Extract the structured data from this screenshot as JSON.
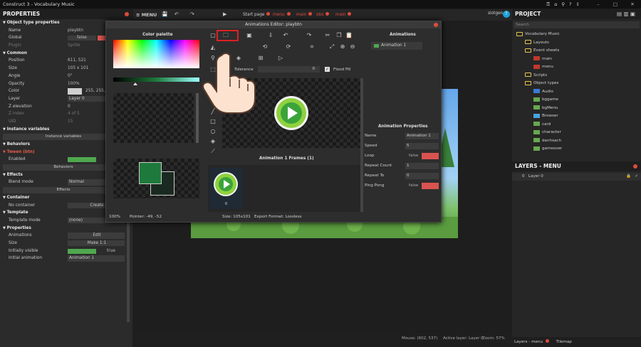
{
  "window": {
    "title": "Construct 3 - Vocabulary Music",
    "min": "–",
    "max": "□",
    "close": "✕"
  },
  "toolbar": {
    "menu_label": "≡ MENU",
    "username": "slotgen",
    "user_badge": "?"
  },
  "tabs": [
    {
      "label": "Start page"
    },
    {
      "label": "menu",
      "active": true
    },
    {
      "label": "main"
    },
    {
      "label": "obs"
    },
    {
      "label": "main"
    }
  ],
  "properties": {
    "header": "PROPERTIES",
    "rows": [
      {
        "type": "sec",
        "label": "Object type properties"
      },
      {
        "label": "Name",
        "value": "playbtn"
      },
      {
        "label": "Global",
        "value": "false"
      },
      {
        "label": "Plugin",
        "value": "Sprite",
        "dim": true
      },
      {
        "type": "sec",
        "label": "Common"
      },
      {
        "label": "Position",
        "value": "611, 521"
      },
      {
        "label": "Size",
        "value": "105 x 101"
      },
      {
        "label": "Angle",
        "value": "0°"
      },
      {
        "label": "Opacity",
        "value": "100%"
      },
      {
        "label": "Color",
        "value": "255, 255, 255"
      },
      {
        "label": "Layer",
        "value": "Layer 0"
      },
      {
        "label": "Z elevation",
        "value": "0"
      },
      {
        "label": "Z index",
        "value": "4 of 5",
        "dim": true
      },
      {
        "label": "UID",
        "value": "15",
        "dim": true
      },
      {
        "type": "sec",
        "label": "Instance variables"
      },
      {
        "type": "btn",
        "label": "Instance variables"
      },
      {
        "type": "sec",
        "label": "Behaviors"
      },
      {
        "type": "sec",
        "label": "Tween (btn)"
      },
      {
        "label": "Enabled",
        "value": ""
      },
      {
        "type": "btn",
        "label": "Behaviors"
      },
      {
        "type": "sec",
        "label": "Effects"
      },
      {
        "label": "Blend mode",
        "value": "Normal"
      },
      {
        "type": "btn",
        "label": "Effects"
      },
      {
        "type": "sec",
        "label": "Container"
      },
      {
        "label": "No container",
        "value": "Create"
      },
      {
        "type": "sec",
        "label": "Template"
      },
      {
        "label": "Template mode",
        "value": "(none)"
      },
      {
        "type": "sec",
        "label": "Properties"
      },
      {
        "label": "Animations",
        "value": "Edit"
      },
      {
        "label": "Size",
        "value": "Make 1:1"
      },
      {
        "label": "Initially visible",
        "value": "true"
      },
      {
        "label": "Initial animation",
        "value": "Animation 1"
      }
    ]
  },
  "project": {
    "header": "PROJECT",
    "search_placeholder": "Search",
    "tree": [
      {
        "label": "Vocabulary Music",
        "depth": 0,
        "icon": "folder-icon"
      },
      {
        "label": "Layouts",
        "depth": 1,
        "icon": "folder-icon"
      },
      {
        "label": "Event sheets",
        "depth": 1,
        "icon": "folder-icon"
      },
      {
        "label": "main",
        "depth": 2,
        "icon": "sheet-icon"
      },
      {
        "label": "menu",
        "depth": 2,
        "icon": "sheet-icon"
      },
      {
        "label": "Scripts",
        "depth": 1,
        "icon": "folder-icon"
      },
      {
        "label": "Object types",
        "depth": 1,
        "icon": "folder-icon"
      },
      {
        "label": "Audio",
        "depth": 2,
        "icon": "audio-icon"
      },
      {
        "label": "bggame",
        "depth": 2,
        "icon": "image-icon"
      },
      {
        "label": "bgMenu",
        "depth": 2,
        "icon": "image-icon"
      },
      {
        "label": "Browser",
        "depth": 2,
        "icon": "browser-icon"
      },
      {
        "label": "card",
        "depth": 2,
        "icon": "image-icon"
      },
      {
        "label": "character",
        "depth": 2,
        "icon": "image-icon"
      },
      {
        "label": "danhsach",
        "depth": 2,
        "icon": "image-icon"
      },
      {
        "label": "gameover",
        "depth": 2,
        "icon": "image-icon"
      }
    ]
  },
  "layers": {
    "header": "LAYERS - MENU",
    "row_index": "0",
    "row_name": "Layer 0",
    "check": "✓"
  },
  "bottom_tabs": {
    "layers": "Layers - menu",
    "tilemap": "Tilemap"
  },
  "status": {
    "mouse": "Mouse: (602, 537)",
    "active_layer": "Active layer: Layer 0",
    "zoom": "Zoom: 57%"
  },
  "editor": {
    "title": "Animations Editor: playbtn",
    "color_palette": "Color palette",
    "tolerance_label": "Tolerance",
    "tolerance_value": "0",
    "flood_fill": "Flood Fill",
    "frames_title": "Animation 1 Frames (1)",
    "frame_number": "0",
    "zoom": "100%",
    "pointer": "Pointer: -49, -52",
    "size": "Size: 105x101",
    "export": "Export Format: Lossless",
    "animations_header": "Animations",
    "animation_item": "Animation 1",
    "anim_props_header": "Animation Properties",
    "anim_props": [
      {
        "label": "Name",
        "value": "Animation 1"
      },
      {
        "label": "Speed",
        "value": "5"
      },
      {
        "label": "Loop",
        "value": "false",
        "bool": true
      },
      {
        "label": "Repeat Count",
        "value": "1"
      },
      {
        "label": "Repeat To",
        "value": "0"
      },
      {
        "label": "Ping Pong",
        "value": "false",
        "bool": true
      }
    ],
    "accent_colors": {
      "primary": "#1e7a3c",
      "secondary": "#1b2a20"
    }
  }
}
